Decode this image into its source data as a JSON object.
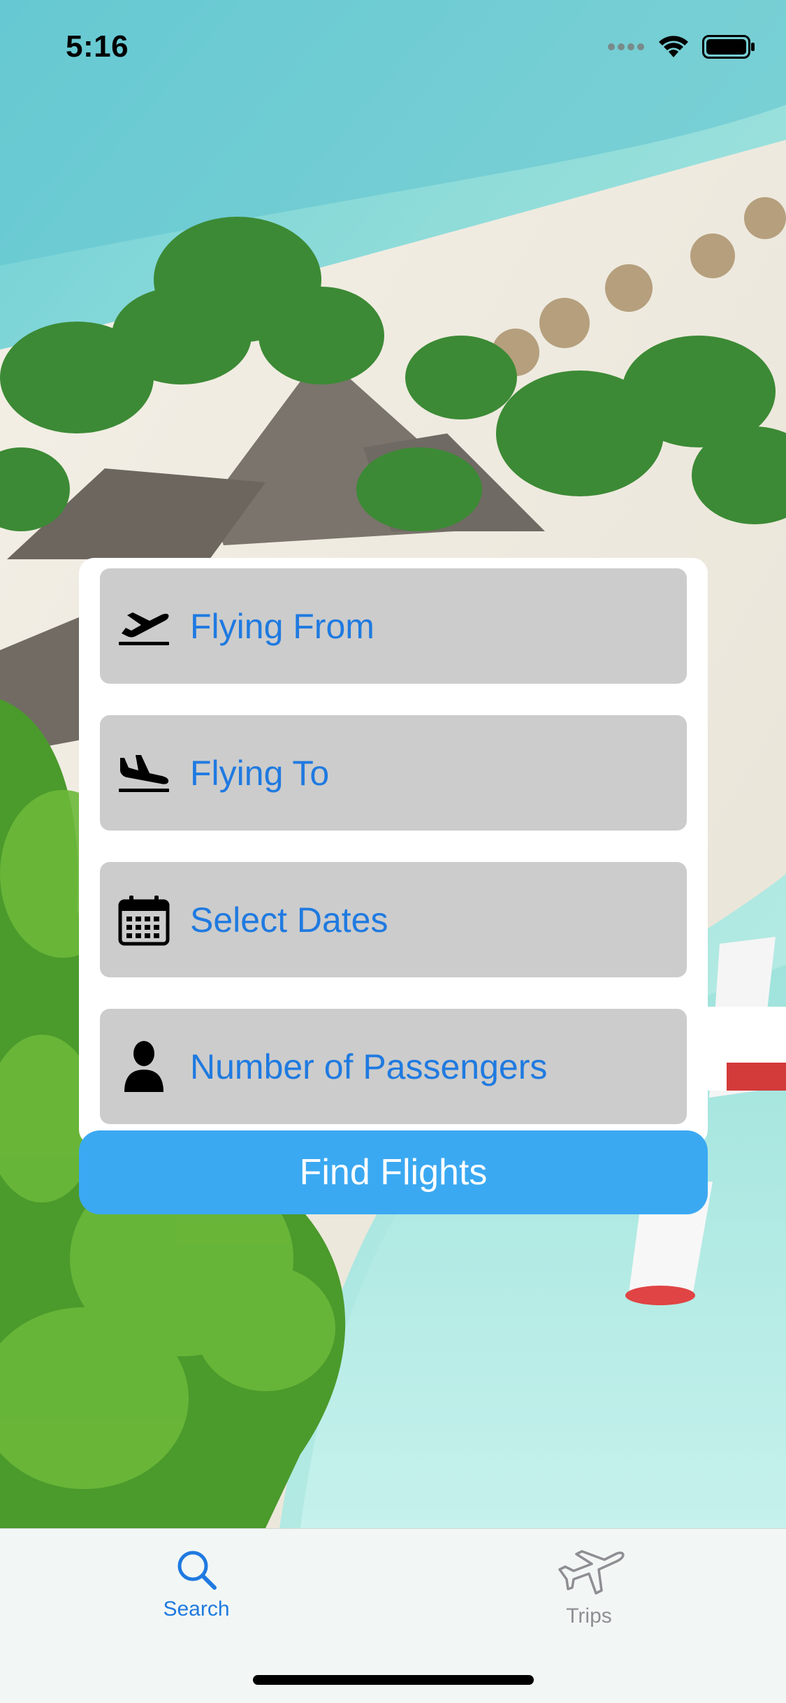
{
  "status_bar": {
    "time": "5:16",
    "icons": [
      "signal-icon",
      "wifi-icon",
      "battery-icon"
    ]
  },
  "form": {
    "fields": [
      {
        "label": "Flying From",
        "icon": "plane-departure-icon"
      },
      {
        "label": "Flying To",
        "icon": "plane-arrival-icon"
      },
      {
        "label": "Select Dates",
        "icon": "calendar-icon"
      },
      {
        "label": "Number of Passengers",
        "icon": "person-icon"
      }
    ],
    "submit_label": "Find Flights"
  },
  "tab_bar": {
    "tabs": [
      {
        "label": "Search",
        "icon": "search-icon",
        "selected": true
      },
      {
        "label": "Trips",
        "icon": "airplane-icon",
        "selected": false
      }
    ]
  },
  "colors": {
    "accent": "#1f7ae0",
    "button": "#3ba9f2",
    "field_background": "#cccccc",
    "inactive_tab": "#8e8e93"
  }
}
